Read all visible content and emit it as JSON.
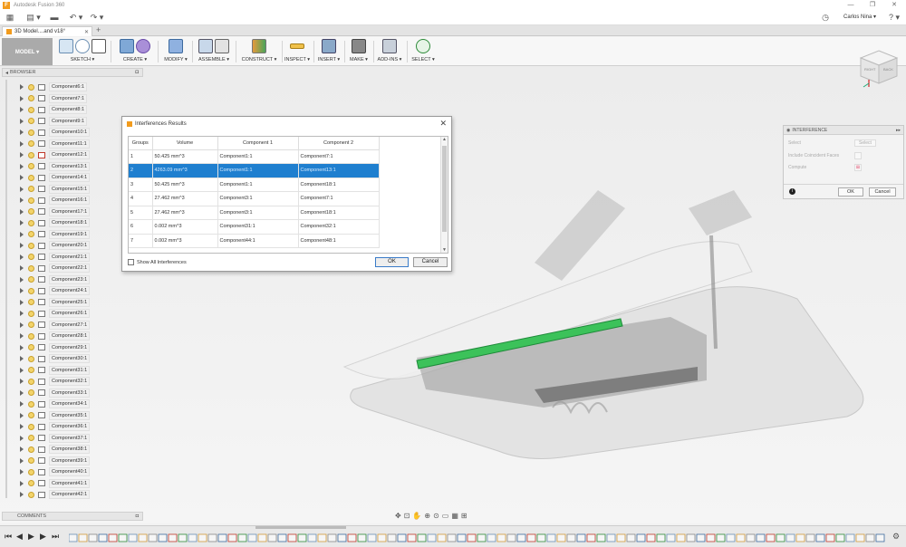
{
  "window": {
    "app_title": "Autodesk Fusion 360",
    "minimize": "—",
    "maximize": "❐",
    "close": "✕"
  },
  "qat": {
    "grid_icon": "▦",
    "file_icon": "▤ ▾",
    "save_icon": "▬",
    "undo_icon": "↶ ▾",
    "redo_icon": "↷ ▾",
    "clock_icon": "◷",
    "user_name": "Carlos Nina ▾",
    "help_icon": "? ▾"
  },
  "tabs": {
    "document_title": "3D Model....and v18°",
    "close_icon": "✕",
    "new_tab": "+"
  },
  "ribbon": {
    "workspace": "MODEL ▾",
    "groups": [
      {
        "label": "SKETCH ▾"
      },
      {
        "label": "CREATE ▾"
      },
      {
        "label": "MODIFY ▾"
      },
      {
        "label": "ASSEMBLE ▾"
      },
      {
        "label": "CONSTRUCT ▾"
      },
      {
        "label": "INSPECT ▾"
      },
      {
        "label": "INSERT ▾"
      },
      {
        "label": "MAKE ▾"
      },
      {
        "label": "ADD-INS ▾"
      },
      {
        "label": "SELECT ▾"
      }
    ]
  },
  "browser": {
    "header": "BROWSER",
    "items": [
      {
        "label": "Component6:1"
      },
      {
        "label": "Component7:1"
      },
      {
        "label": "Component8:1"
      },
      {
        "label": "Component9:1"
      },
      {
        "label": "Component10:1"
      },
      {
        "label": "Component11:1"
      },
      {
        "label": "Component12:1"
      },
      {
        "label": "Component13:1"
      },
      {
        "label": "Component14:1"
      },
      {
        "label": "Component15:1"
      },
      {
        "label": "Component16:1"
      },
      {
        "label": "Component17:1"
      },
      {
        "label": "Component18:1"
      },
      {
        "label": "Component19:1"
      },
      {
        "label": "Component20:1"
      },
      {
        "label": "Component21:1"
      },
      {
        "label": "Component22:1"
      },
      {
        "label": "Component23:1"
      },
      {
        "label": "Component24:1"
      },
      {
        "label": "Component25:1"
      },
      {
        "label": "Component26:1"
      },
      {
        "label": "Component27:1"
      },
      {
        "label": "Component28:1"
      },
      {
        "label": "Component29:1"
      },
      {
        "label": "Component30:1"
      },
      {
        "label": "Component31:1"
      },
      {
        "label": "Component32:1"
      },
      {
        "label": "Component33:1"
      },
      {
        "label": "Component34:1"
      },
      {
        "label": "Component35:1"
      },
      {
        "label": "Component36:1"
      },
      {
        "label": "Component37:1"
      },
      {
        "label": "Component38:1"
      },
      {
        "label": "Component39:1"
      },
      {
        "label": "Component40:1"
      },
      {
        "label": "Component41:1"
      },
      {
        "label": "Component42:1"
      }
    ]
  },
  "comments": {
    "label": "COMMENTS"
  },
  "interference_dialog": {
    "title": "Interferences Results",
    "columns": [
      "Groups",
      "Volume",
      "Component 1",
      "Component 2"
    ],
    "rows": [
      {
        "group": "1",
        "volume": "50.425 mm^3",
        "c1": "Component1:1",
        "c2": "Component7:1",
        "selected": false
      },
      {
        "group": "2",
        "volume": "4263.09 mm^3",
        "c1": "Component1:1",
        "c2": "Component13:1",
        "selected": true
      },
      {
        "group": "3",
        "volume": "50.425 mm^3",
        "c1": "Component1:1",
        "c2": "Component18:1",
        "selected": false
      },
      {
        "group": "4",
        "volume": "27.462 mm^3",
        "c1": "Component3:1",
        "c2": "Component7:1",
        "selected": false
      },
      {
        "group": "5",
        "volume": "27.462 mm^3",
        "c1": "Component3:1",
        "c2": "Component18:1",
        "selected": false
      },
      {
        "group": "6",
        "volume": "0.002 mm^3",
        "c1": "Component31:1",
        "c2": "Component32:1",
        "selected": false
      },
      {
        "group": "7",
        "volume": "0.002 mm^3",
        "c1": "Component44:1",
        "c2": "Component48:1",
        "selected": false
      }
    ],
    "show_all_label": "Show All Interferences",
    "ok_label": "OK",
    "cancel_label": "Cancel"
  },
  "interference_panel": {
    "title": "INTERFERENCE",
    "select_label": "Select",
    "select_value": "Select",
    "include_coincident_label": "Include Coincident Faces",
    "compute_label": "Compute",
    "ok_label": "OK",
    "cancel_label": "Cancel"
  },
  "viewcube": {
    "right_face": "BACK",
    "left_face": "RIGHT"
  },
  "colors": {
    "accent": "#1f7fcf",
    "highlight_green": "#3cc25a",
    "bulb": "#f3d46a"
  }
}
